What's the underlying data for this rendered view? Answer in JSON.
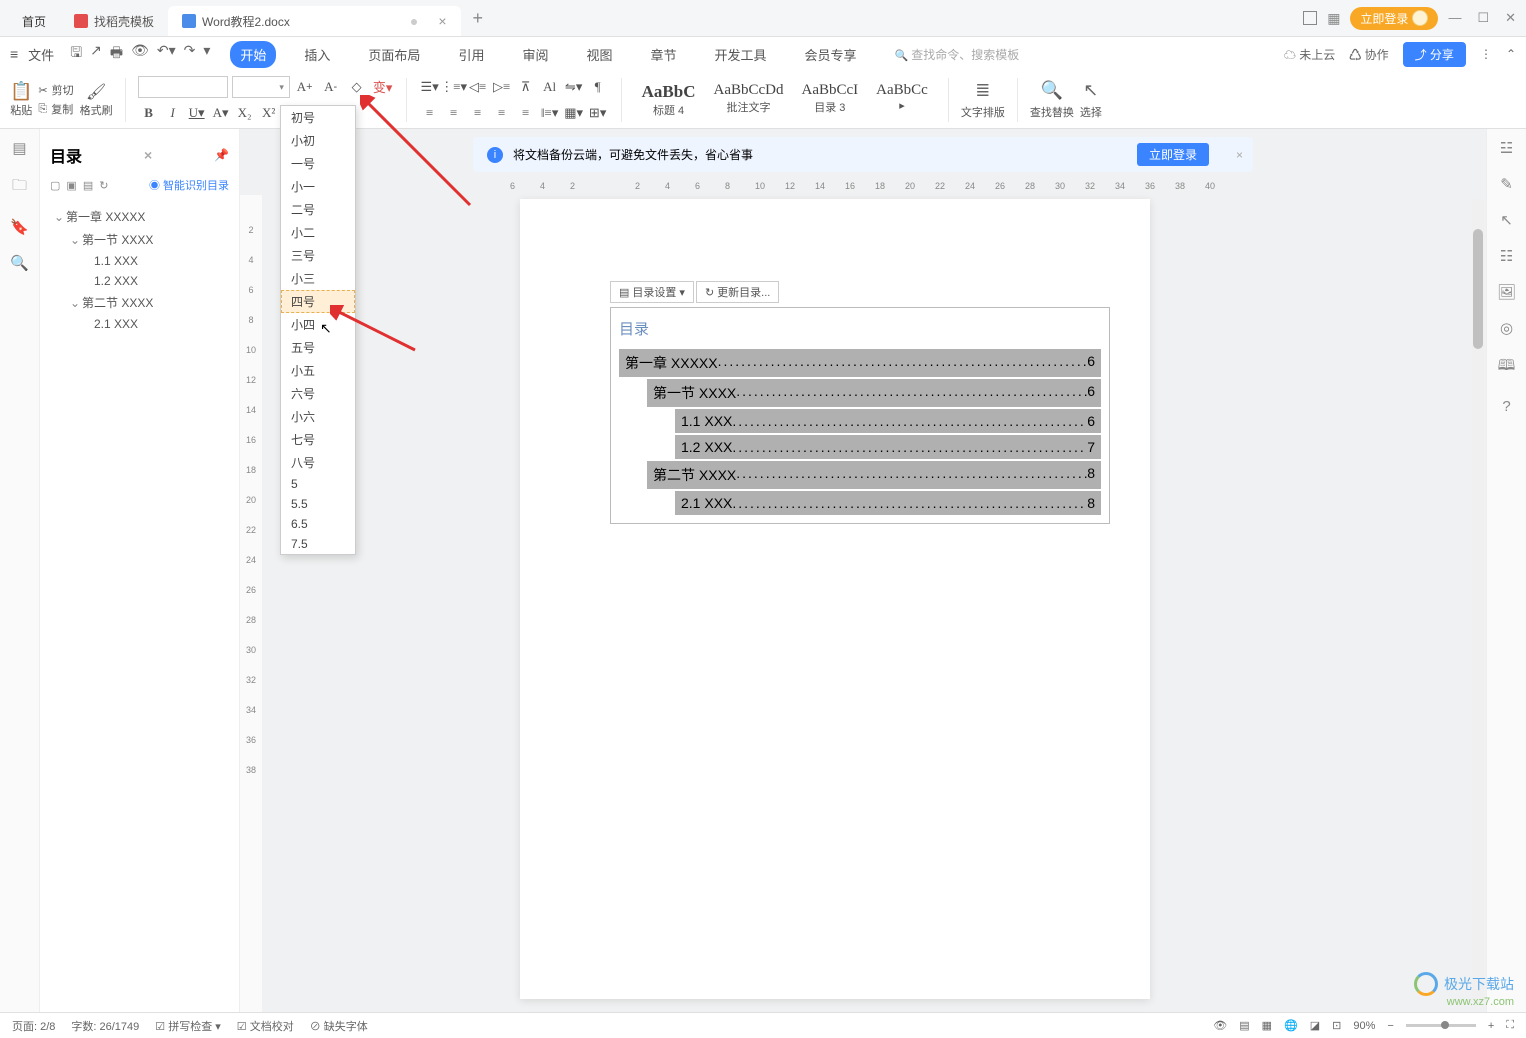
{
  "tabs": {
    "home": "首页",
    "template": "找稻壳模板",
    "active_doc": "Word教程2.docx"
  },
  "login_pill": "立即登录",
  "menu": {
    "file": "文件",
    "items": [
      "开始",
      "插入",
      "页面布局",
      "引用",
      "审阅",
      "视图",
      "章节",
      "开发工具",
      "会员专享"
    ],
    "search_placeholder": "查找命令、搜索模板",
    "cloud": "未上云",
    "collab": "协作",
    "share": "分享"
  },
  "ribbon": {
    "paste": "粘贴",
    "cut": "剪切",
    "copy": "复制",
    "format_painter": "格式刷",
    "styles": [
      {
        "preview": "AaBbC",
        "label": "标题 4"
      },
      {
        "preview": "AaBbCcDd",
        "label": "批注文字"
      },
      {
        "preview": "AaBbCcI",
        "label": "目录 3"
      },
      {
        "preview": "AaBbCc",
        "label": ""
      }
    ],
    "text_layout": "文字排版",
    "find_replace": "查找替换",
    "select": "选择"
  },
  "font_sizes": [
    "初号",
    "小初",
    "一号",
    "小一",
    "二号",
    "小二",
    "三号",
    "小三",
    "四号",
    "小四",
    "五号",
    "小五",
    "六号",
    "小六",
    "七号",
    "八号",
    "5",
    "5.5",
    "6.5",
    "7.5"
  ],
  "highlighted_size": "四号",
  "outline": {
    "title": "目录",
    "smart": "智能识别目录",
    "tree": [
      {
        "level": 0,
        "text": "第一章  XXXXX"
      },
      {
        "level": 1,
        "text": "第一节  XXXX"
      },
      {
        "level": 2,
        "text": "1.1 XXX"
      },
      {
        "level": 2,
        "text": "1.2 XXX"
      },
      {
        "level": 1,
        "text": "第二节  XXXX"
      },
      {
        "level": 2,
        "text": "2.1 XXX"
      }
    ]
  },
  "cloud_banner": {
    "text": "将文档备份云端，可避免文件丢失，省心省事",
    "button": "立即登录"
  },
  "ruler_marks": [
    "6",
    "4",
    "2",
    "2",
    "4",
    "6",
    "8",
    "10",
    "12",
    "14",
    "16",
    "18",
    "20",
    "22",
    "24",
    "26",
    "28",
    "30",
    "32",
    "34",
    "36",
    "38",
    "40"
  ],
  "toc_toolbar": {
    "settings": "目录设置",
    "update": "更新目录..."
  },
  "doc_toc": {
    "title": "目录",
    "lines": [
      {
        "level": 1,
        "text": "第一章  XXXXX",
        "page": "6"
      },
      {
        "level": 2,
        "text": "第一节  XXXX",
        "page": "6"
      },
      {
        "level": 3,
        "text": "1.1 XXX",
        "page": "6"
      },
      {
        "level": 3,
        "text": "1.2 XXX",
        "page": "7"
      },
      {
        "level": 2,
        "text": "第二节  XXXX",
        "page": "8"
      },
      {
        "level": 3,
        "text": "2.1 XXX",
        "page": "8"
      }
    ]
  },
  "status": {
    "page": "页面: 2/8",
    "words": "字数: 26/1749",
    "spell": "拼写检查",
    "compare": "文档校对",
    "missing_font": "缺失字体",
    "zoom": "90%"
  },
  "watermark": {
    "main": "极光下载站",
    "sub": "www.xz7.com"
  }
}
